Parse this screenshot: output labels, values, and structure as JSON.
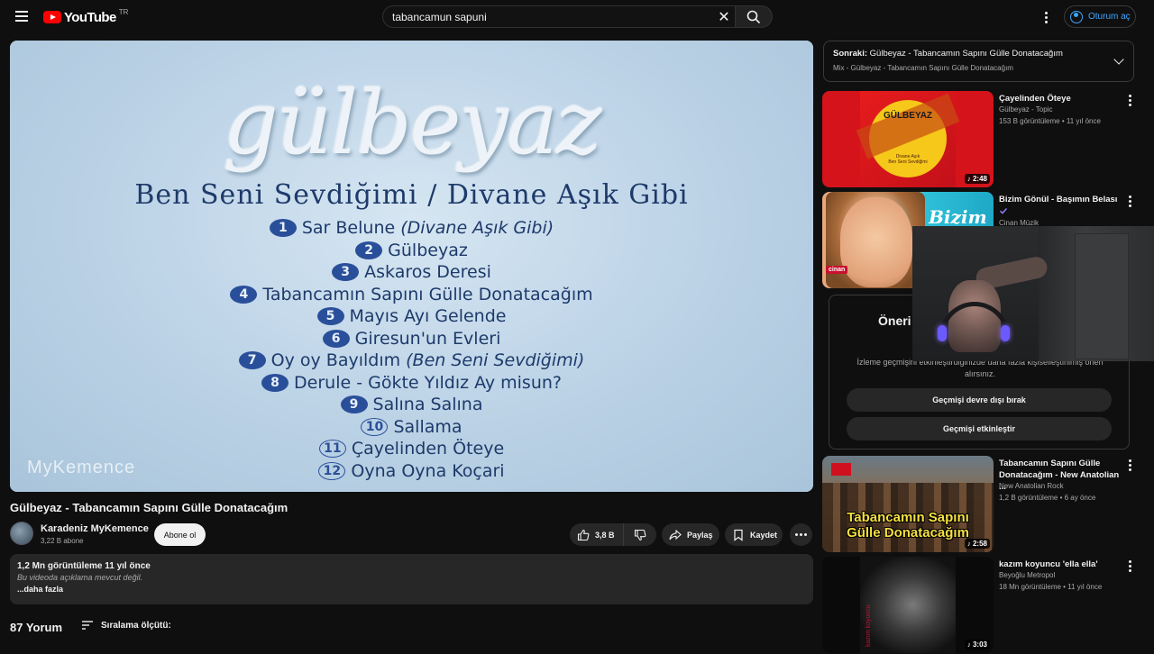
{
  "header": {
    "logo_text": "YouTube",
    "country": "TR",
    "search_value": "tabancamun sapuni",
    "signin_label": "Oturum aç"
  },
  "player": {
    "title_art": "gülbeyaz",
    "album": "Ben Seni Sevdiğimi / Divane Aşık Gibi",
    "tracks": [
      {
        "num": "1",
        "name": "Sar Belune",
        "extra": "(Divane Aşık Gibi)"
      },
      {
        "num": "2",
        "name": "Gülbeyaz",
        "extra": ""
      },
      {
        "num": "3",
        "name": "Askaros Deresi",
        "extra": ""
      },
      {
        "num": "4",
        "name": "Tabancamın Sapını Gülle Donatacağım",
        "extra": ""
      },
      {
        "num": "5",
        "name": "Mayıs Ayı Gelende",
        "extra": ""
      },
      {
        "num": "6",
        "name": "Giresun'un Evleri",
        "extra": ""
      },
      {
        "num": "7",
        "name": "Oy oy Bayıldım",
        "extra": "(Ben Seni Sevdiğimi)"
      },
      {
        "num": "8",
        "name": "Derule - Gökte Yıldız Ay misun?",
        "extra": ""
      },
      {
        "num": "9",
        "name": "Salına Salına",
        "extra": ""
      },
      {
        "num": "10",
        "name": "Sallama",
        "extra": ""
      },
      {
        "num": "11",
        "name": "Çayelinden Öteye",
        "extra": ""
      },
      {
        "num": "12",
        "name": "Oyna Oyna Koçari",
        "extra": ""
      }
    ],
    "watermark": "MyKemence"
  },
  "video": {
    "title": "Gülbeyaz - Tabancamın Sapını Gülle Donatacağım",
    "channel": "Karadeniz MyKemence",
    "subscribers": "3,22 B abone",
    "subscribe_label": "Abone ol",
    "likes": "3,8 B",
    "share_label": "Paylaş",
    "save_label": "Kaydet"
  },
  "description": {
    "meta": "1,2 Mn görüntüleme  11 yıl önce",
    "text": "Bu videoda açıklama mevcut değil.",
    "more": "...daha fazla"
  },
  "comments": {
    "count": "87 Yorum",
    "sort_label": "Sıralama ölçütü:"
  },
  "upnext": {
    "prefix": "Sonraki:",
    "title": "Gülbeyaz - Tabancamın Sapını Gülle Donatacağım",
    "sub": "Mix - Gülbeyaz - Tabancamın Sapını Gülle Donatacağım"
  },
  "recommendations": [
    {
      "title": "Çayelinden Öteye",
      "channel": "Gülbeyaz - Topic",
      "meta": "153 B görüntüleme • 11 yıl önce",
      "duration": "2:48",
      "thumb_text": "GÜLBEYAZ",
      "thumb_small": "Divane Aşık\nBen Seni Sevdiğimi"
    },
    {
      "title": "Bizim Gönül - Başımın Belası",
      "channel": "Cinan Müzik",
      "meta": "",
      "duration": "",
      "thumb_text": "Bizim",
      "thumb_logo": "cinan"
    },
    {
      "title": "Tabancamın Sapını Gülle Donatacağım - New Anatolian ...",
      "channel": "New Anatolian Rock",
      "meta": "1,2 B görüntüleme • 6 ay önce",
      "duration": "2:58",
      "thumb_line1": "Tabancamın Sapını",
      "thumb_line2": "Gülle Donatacağım"
    },
    {
      "title": "kazım koyuncu 'ella ella'",
      "channel": "Beyoğlu Metropol",
      "meta": "18 Mn görüntüleme • 11 yıl önce",
      "duration": "3:03",
      "thumb_text": "kazım koyuncu"
    }
  ],
  "suggestions": {
    "title": "Öneri",
    "text": "İzleme geçmişini etkinleştirdiğinizde daha fazla kişiselleştirilmiş öneri alırsınız.",
    "btn_disable": "Geçmişi devre dışı bırak",
    "btn_enable": "Geçmişi etkinleştir"
  },
  "colors": {
    "background": "#0f0f0f",
    "accent_red": "#ff0000",
    "link_blue": "#3ea6ff",
    "pill": "#272727"
  }
}
